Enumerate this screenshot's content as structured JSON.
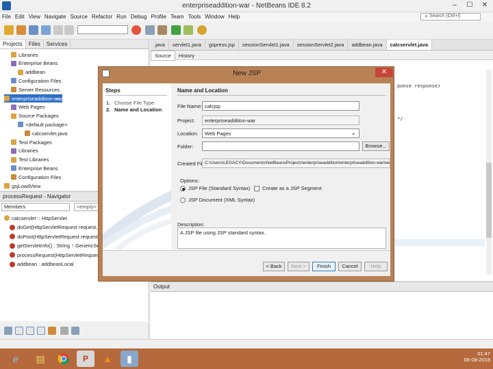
{
  "window": {
    "title": "enterpriseaddition-war - NetBeans IDE 8.2",
    "minimize": "–",
    "maximize": "☐",
    "close": "✕"
  },
  "menu": [
    "File",
    "Edit",
    "View",
    "Navigate",
    "Source",
    "Refactor",
    "Run",
    "Debug",
    "Profile",
    "Team",
    "Tools",
    "Window",
    "Help"
  ],
  "search": {
    "placeholder": "Search (Ctrl+I)"
  },
  "project_tabs": [
    "Projects",
    "Files",
    "Services"
  ],
  "tree": [
    {
      "label": "Libraries",
      "indent": 1
    },
    {
      "label": "Enterprise Beans",
      "indent": 1
    },
    {
      "label": "addbean",
      "indent": 2
    },
    {
      "label": "Configuration Files",
      "indent": 1
    },
    {
      "label": "Server Resources",
      "indent": 1
    },
    {
      "label": "enterpriseaddition-war",
      "indent": 0,
      "selected": true
    },
    {
      "label": "Web Pages",
      "indent": 1
    },
    {
      "label": "Source Packages",
      "indent": 1
    },
    {
      "label": "<default package>",
      "indent": 2
    },
    {
      "label": "calcservlet.java",
      "indent": 3
    },
    {
      "label": "Test Packages",
      "indent": 1
    },
    {
      "label": "Libraries",
      "indent": 1
    },
    {
      "label": "Test Libraries",
      "indent": 1
    },
    {
      "label": "Enterprise Beans",
      "indent": 1
    },
    {
      "label": "Configuration Files",
      "indent": 1
    },
    {
      "label": "gsjLoadView",
      "indent": 0
    }
  ],
  "navigator": {
    "title": "processRequest - Navigator",
    "combo": "Members",
    "combo2": "<empty>",
    "items": [
      {
        "label": "calcservlet :: HttpServlet",
        "indent": 0
      },
      {
        "label": "doGet(HttpServletRequest request, HttpServl...",
        "indent": 1
      },
      {
        "label": "doPost(HttpServletRequest request, HttpServl...",
        "indent": 1
      },
      {
        "label": "getServletInfo() : String ↑ GenericServlet",
        "indent": 1
      },
      {
        "label": "processRequest(HttpServletRequest request...",
        "indent": 1
      },
      {
        "label": "addbean : addbeanLocal",
        "indent": 1
      }
    ]
  },
  "editor": {
    "tabs": [
      ".java",
      "servlet1.java",
      "gspress.jsp",
      "sessionServlet1.java",
      "sessionServlet2.java",
      "addbean.java",
      "calcservlet.java"
    ],
    "active_tab": "calcservlet.java",
    "subtabs": [
      "Source",
      "History"
    ],
    "code_fragments": [
      "ponse response)",
      "*/"
    ]
  },
  "output": {
    "title": "Output"
  },
  "dialog": {
    "title": "New JSP",
    "close": "✕",
    "steps_heading": "Steps",
    "steps": [
      {
        "num": "1.",
        "label": "Choose File Type"
      },
      {
        "num": "2.",
        "label": "Name and Location"
      }
    ],
    "pane_heading": "Name and Location",
    "fields": {
      "file_name_label": "File Name:",
      "file_name": "calcjsp",
      "project_label": "Project:",
      "project": "enterpriseaddition-war",
      "location_label": "Location:",
      "location": "Web Pages",
      "folder_label": "Folder:",
      "folder": "",
      "browse": "Browse...",
      "created_file_label": "Created File:",
      "created_file": "C:\\Users\\LEGACY\\Documents\\NetBeansProjects\\enterpriseaddition\\enterpriseaddition-war\\web\\calcjsp.jsp"
    },
    "options_label": "Options:",
    "options": {
      "jsp_file": "JSP File (Standard Syntax)",
      "jsp_document": "JSP Document (XML Syntax)",
      "segment": "Create as a JSP Segment"
    },
    "description_label": "Description:",
    "description": "A JSP file using JSP standard syntax.",
    "buttons": {
      "back": "< Back",
      "next": "Next >",
      "finish": "Finish",
      "cancel": "Cancel",
      "help": "Help"
    }
  },
  "tray": {
    "time": "01:47",
    "date": "06-08-2018"
  },
  "colors": {
    "accent": "#2f70c7",
    "taskbar": "#b5693c",
    "dialog_border": "#b98254"
  }
}
